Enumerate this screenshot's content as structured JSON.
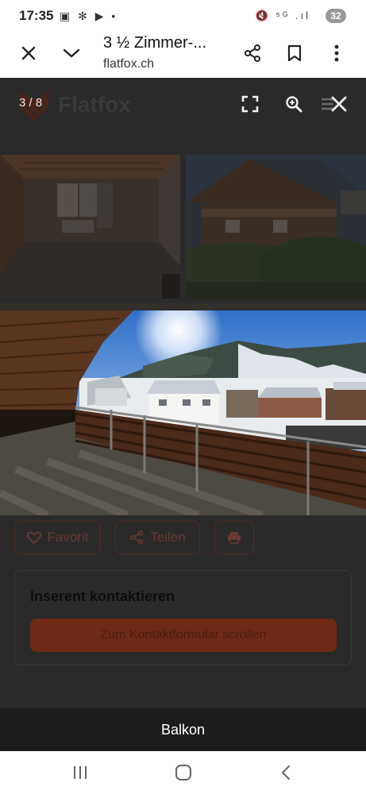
{
  "status": {
    "time": "17:35",
    "left_icons": "▣ ✻ ▶ •",
    "right_icons": "🔇 ⁵ᴳ .ıl",
    "battery": "32"
  },
  "browser": {
    "title": "3 ½ Zimmer-...",
    "url": "flatfox.ch"
  },
  "site": {
    "logo_text": "Flatfox",
    "counter": "3 / 8"
  },
  "actions": {
    "favorite_label": "Favorit",
    "share_label": "Teilen"
  },
  "contact": {
    "title": "Inserent kontaktieren",
    "button_label": "Zum Kontaktformular scrollen"
  },
  "caption": "Balkon",
  "colors": {
    "brand": "#c9442a",
    "overlay": "#2a2a2a",
    "caption_bg": "#1c1c1c"
  }
}
